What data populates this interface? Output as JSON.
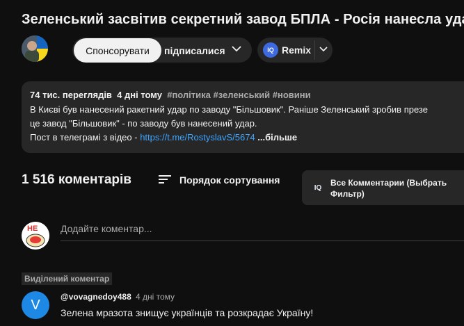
{
  "video": {
    "title": "Зеленський засвітив секретний завод БПЛА - Росія нанесла удар"
  },
  "channel": {
    "subscribe_label": "Ви підписалися",
    "subscribe_visible": "підписалися",
    "tooltip": "Спонсорувати",
    "remix_label": "Remix",
    "remix_badge": "IQ"
  },
  "description": {
    "views": "74 тис. переглядів",
    "age": "4 дні тому",
    "tags": "#політика #зеленський #новини",
    "line1": "В Києві був нанесений ракетний удар по заводу \"Більшовик\". Раніше Зеленський зробив презе",
    "line2": "це завод \"Більшовик\" - по заводу був нанесений удар.",
    "line3_prefix": "Пост в телеграмі з відео - ",
    "link": "https://t.me/RostyslavS/5674",
    "more": "...більше"
  },
  "comments": {
    "count_label": "1 516 коментарів",
    "sort_label": "Порядок сортування",
    "filter_badge": "IQ",
    "filter_label": "Все Комментарии (Выбрать Фильтр)",
    "add_placeholder": "Додайте коментар...",
    "user_avatar_text": "НЕ",
    "pinned_label": "Виділений коментар",
    "items": [
      {
        "avatar_letter": "V",
        "author": "@vovagnedoy488",
        "time": "4 дні тому",
        "text": "Зелена мразота знищує українців та розкрадає Україну!"
      }
    ]
  },
  "colors": {
    "background": "#0f0f0f",
    "surface": "#272727",
    "link": "#3ea6ff",
    "iq_blue": "#3e6ae1",
    "comment_avatar": "#1e88e5"
  }
}
